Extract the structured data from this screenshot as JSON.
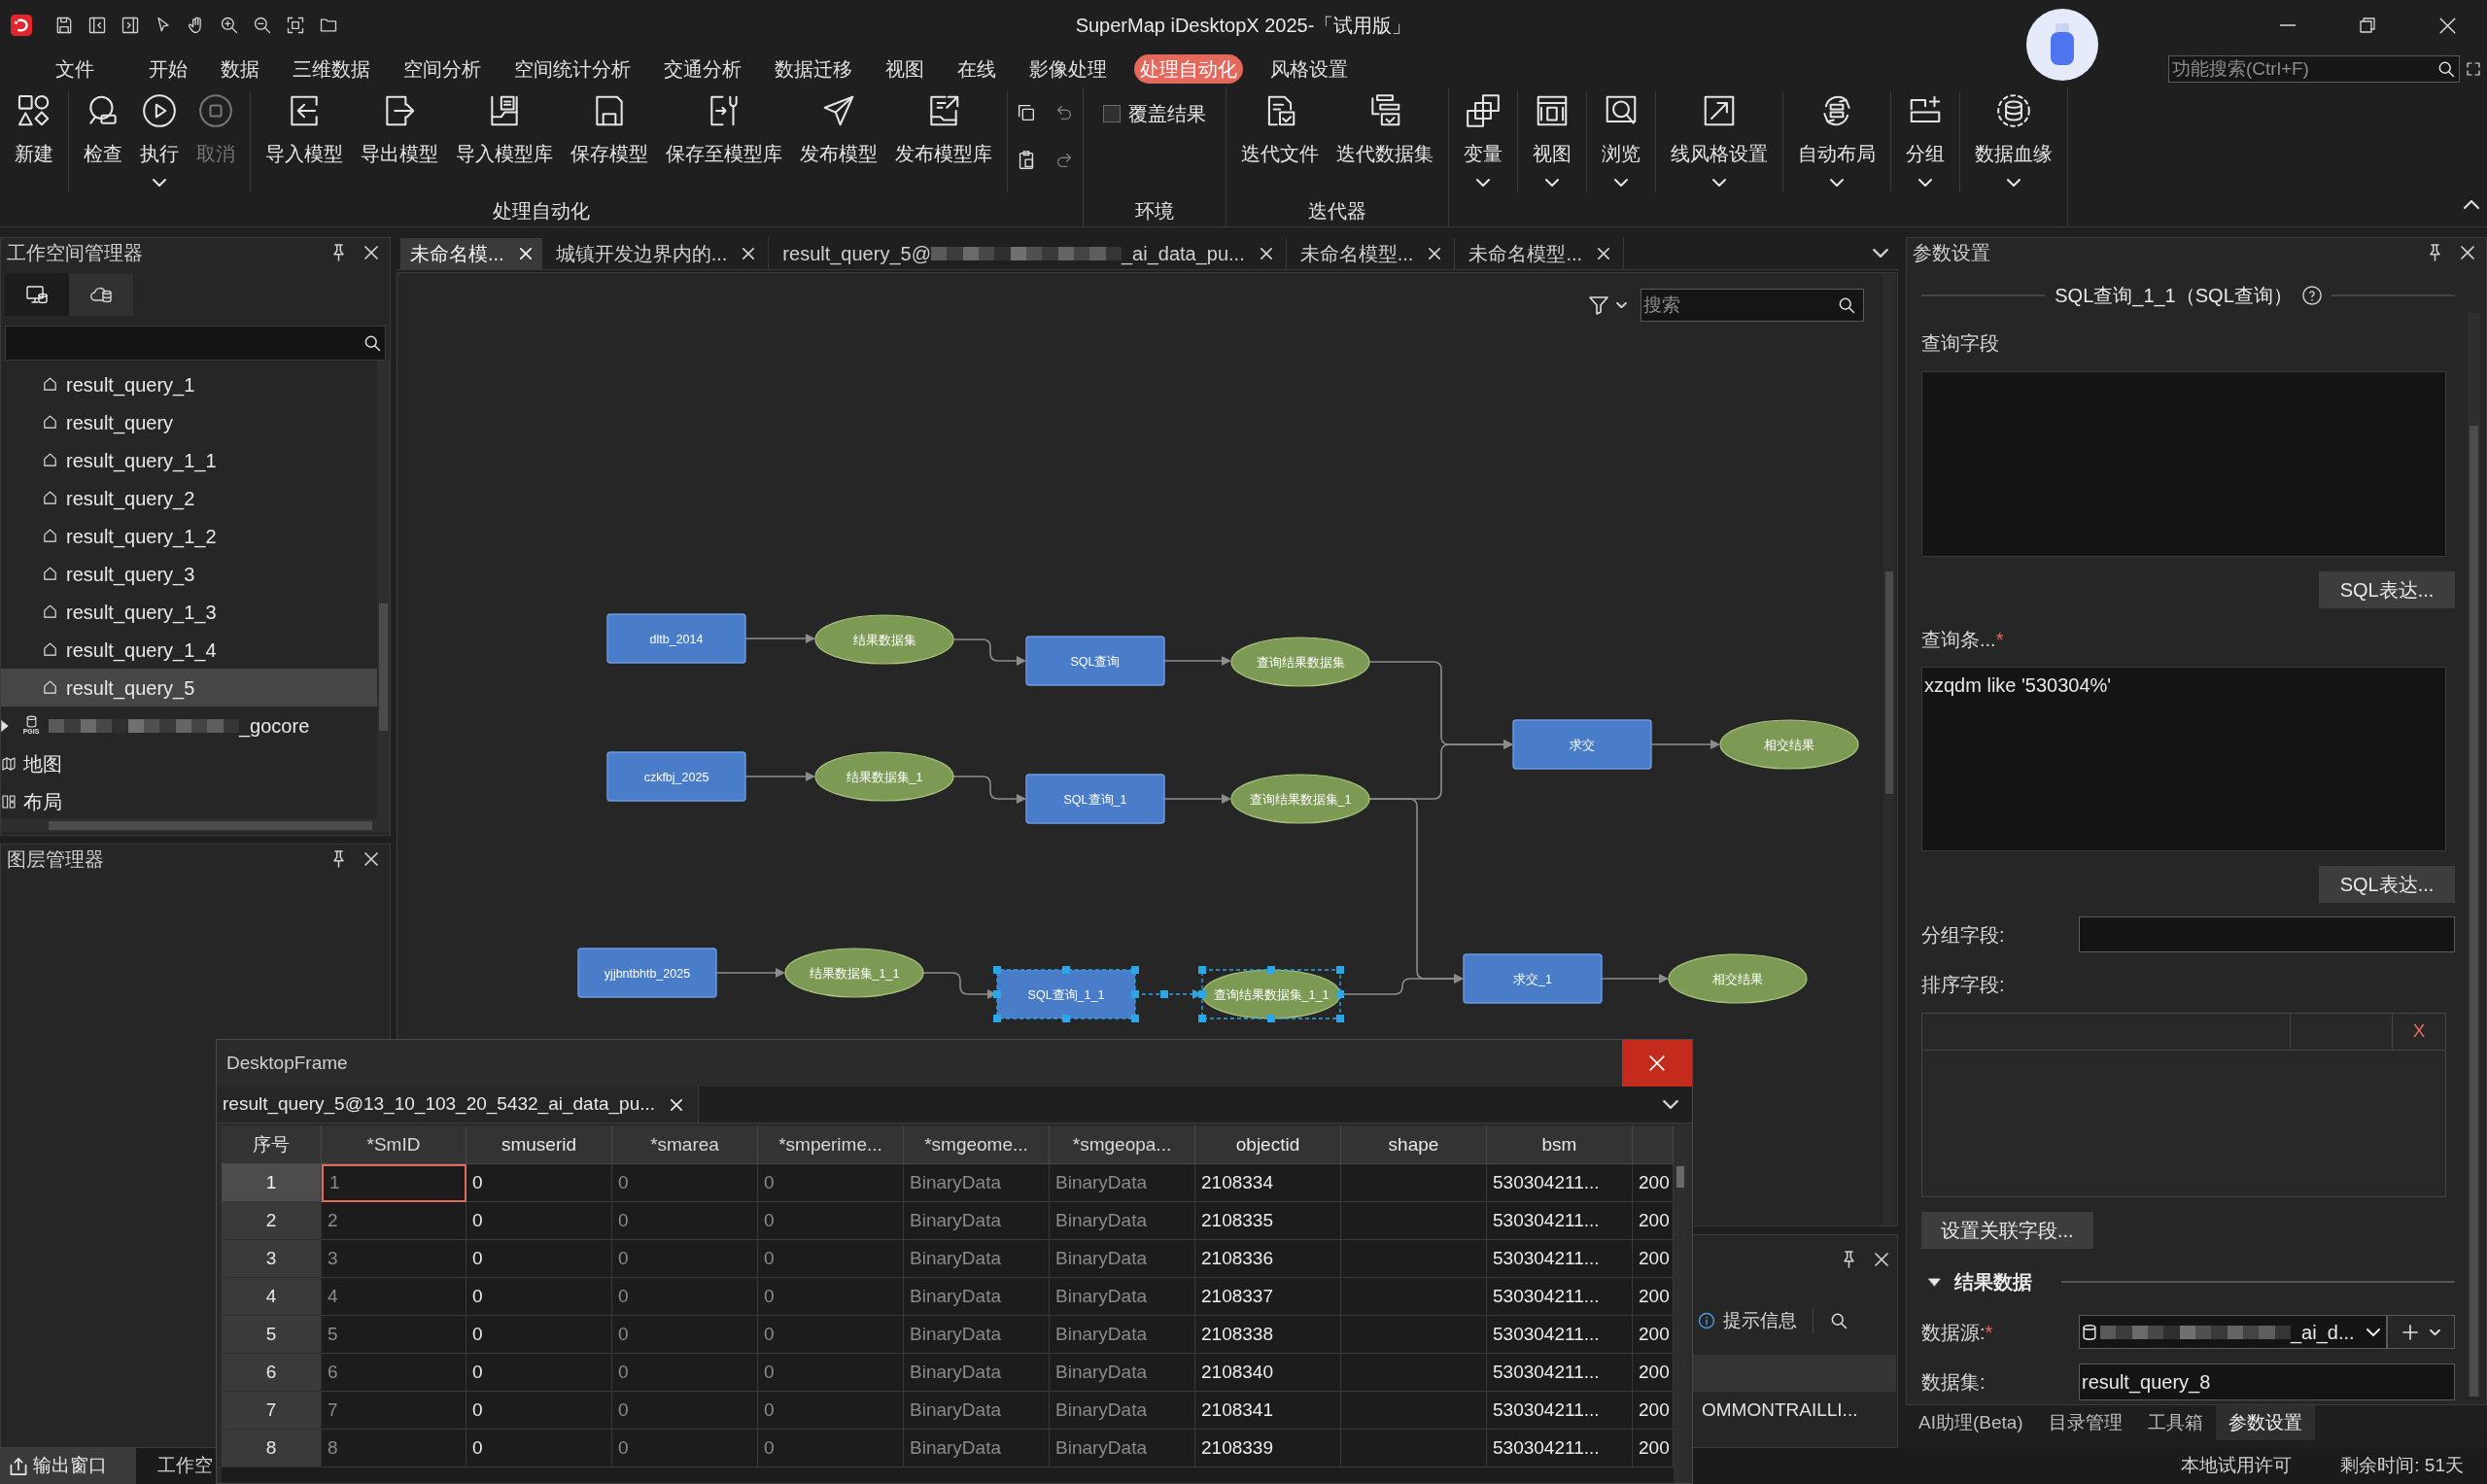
{
  "title_bar": {
    "title": "SuperMap iDesktopX 2025-「试用版」"
  },
  "menu_bar": {
    "items": [
      {
        "label": "文件",
        "selected": false
      },
      {
        "label": "开始",
        "selected": false
      },
      {
        "label": "数据",
        "selected": false
      },
      {
        "label": "三维数据",
        "selected": false
      },
      {
        "label": "空间分析",
        "selected": false
      },
      {
        "label": "空间统计分析",
        "selected": false
      },
      {
        "label": "交通分析",
        "selected": false
      },
      {
        "label": "数据迁移",
        "selected": false
      },
      {
        "label": "视图",
        "selected": false
      },
      {
        "label": "在线",
        "selected": false
      },
      {
        "label": "影像处理",
        "selected": false
      },
      {
        "label": "处理自动化",
        "selected": true
      },
      {
        "label": "风格设置",
        "selected": false
      }
    ],
    "search": {
      "placeholder": "功能搜索(Ctrl+F)"
    }
  },
  "ribbon": {
    "groups": [
      {
        "label": "处理自动化",
        "sections": [
          [
            {
              "kind": "large",
              "label": "新建",
              "dropdown": false,
              "disabled": false
            }
          ],
          [
            {
              "kind": "large",
              "label": "检查",
              "dropdown": false,
              "disabled": false
            },
            {
              "kind": "large",
              "label": "执行",
              "dropdown": true,
              "disabled": false
            },
            {
              "kind": "large",
              "label": "取消",
              "dropdown": false,
              "disabled": true
            }
          ],
          [
            {
              "kind": "large",
              "label": "导入模型",
              "dropdown": false,
              "disabled": false
            },
            {
              "kind": "large",
              "label": "导出模型",
              "dropdown": false,
              "disabled": false
            },
            {
              "kind": "large",
              "label": "导入模型库",
              "dropdown": false,
              "disabled": false
            },
            {
              "kind": "large",
              "label": "保存模型",
              "dropdown": false,
              "disabled": false
            },
            {
              "kind": "large",
              "label": "保存至模型库",
              "dropdown": false,
              "disabled": false
            },
            {
              "kind": "large",
              "label": "发布模型",
              "dropdown": false,
              "disabled": false
            },
            {
              "kind": "large",
              "label": "发布模型库",
              "dropdown": false,
              "disabled": false
            }
          ],
          [
            {
              "kind": "small",
              "disabled": false
            },
            {
              "kind": "small",
              "disabled": true
            },
            {
              "kind": "small",
              "disabled": false
            },
            {
              "kind": "small",
              "disabled": true
            }
          ]
        ]
      },
      {
        "label": "环境",
        "sections": [
          [
            {
              "kind": "checkbox",
              "label": "覆盖结果",
              "checked": false
            }
          ]
        ]
      },
      {
        "label": "迭代器",
        "sections": [
          [
            {
              "kind": "large",
              "label": "迭代文件",
              "dropdown": false,
              "disabled": false
            },
            {
              "kind": "large",
              "label": "迭代数据集",
              "dropdown": false,
              "disabled": false
            }
          ]
        ]
      },
      {
        "sections": [
          [
            {
              "kind": "large",
              "label": "变量",
              "dropdown": true,
              "disabled": false
            }
          ],
          [
            {
              "kind": "large",
              "label": "视图",
              "dropdown": true,
              "disabled": false
            }
          ],
          [
            {
              "kind": "large",
              "label": "浏览",
              "dropdown": true,
              "disabled": false
            }
          ],
          [
            {
              "kind": "large",
              "label": "线风格设置",
              "dropdown": true,
              "disabled": false
            }
          ],
          [
            {
              "kind": "large",
              "label": "自动布局",
              "dropdown": true,
              "disabled": false
            }
          ],
          [
            {
              "kind": "large",
              "label": "分组",
              "dropdown": true,
              "disabled": false
            }
          ],
          [
            {
              "kind": "large",
              "label": "数据血缘",
              "dropdown": true,
              "disabled": false
            }
          ]
        ]
      }
    ]
  },
  "workspace_panel": {
    "title": "工作空间管理器",
    "tabs": [
      {
        "selected": true
      },
      {
        "selected": false
      }
    ],
    "tree": [
      {
        "children": [
          {
            "children": [
              {
                "kind": "dataset",
                "label": "result_query_1",
                "selected": false
              },
              {
                "kind": "dataset",
                "label": "result_query",
                "selected": false
              },
              {
                "kind": "dataset",
                "label": "result_query_1_1",
                "selected": false
              },
              {
                "kind": "dataset",
                "label": "result_query_2",
                "selected": false
              },
              {
                "kind": "dataset",
                "label": "result_query_1_2",
                "selected": false
              },
              {
                "kind": "dataset",
                "label": "result_query_3",
                "selected": false
              },
              {
                "kind": "dataset",
                "label": "result_query_1_3",
                "selected": false
              },
              {
                "kind": "dataset",
                "label": "result_query_1_4",
                "selected": false
              },
              {
                "kind": "dataset",
                "label": "result_query_5",
                "selected": true
              }
            ]
          },
          {
            "kind": "datasource",
            "badge": "PGIS",
            "segments": [
              {
                "kind": "redacted"
              },
              {
                "kind": "text",
                "text": "_gocore"
              }
            ],
            "expanded": false,
            "selected": false
          }
        ]
      },
      {
        "kind": "maps",
        "label": "地图",
        "selected": false
      },
      {
        "kind": "layouts",
        "label": "布局",
        "selected": false
      }
    ]
  },
  "layer_panel": {
    "title": "图层管理器"
  },
  "document_tabs": [
    {
      "label": "未命名模...",
      "selected": true
    },
    {
      "label": "城镇开发边界内的...",
      "selected": false
    },
    {
      "segments": [
        {
          "kind": "text",
          "text": "result_query_5@"
        },
        {
          "kind": "redacted"
        },
        {
          "kind": "text",
          "text": "_ai_data_pu..."
        }
      ],
      "selected": false
    },
    {
      "label": "未命名模型...",
      "selected": false
    },
    {
      "label": "未命名模型...",
      "selected": false
    }
  ],
  "model_canvas": {
    "search": {
      "placeholder": "搜索"
    },
    "nodes": [
      {
        "kind": "process",
        "label": "dltb_2014",
        "selected": false
      },
      {
        "kind": "data",
        "label": "结果数据集",
        "selected": false
      },
      {
        "kind": "process",
        "label": "SQL查询",
        "selected": false
      },
      {
        "kind": "data",
        "label": "查询结果数据集",
        "selected": false
      },
      {
        "kind": "process",
        "label": "求交",
        "selected": false
      },
      {
        "kind": "data",
        "label": "相交结果",
        "selected": false
      },
      {
        "kind": "process",
        "label": "czkfbj_2025",
        "selected": false
      },
      {
        "kind": "data",
        "label": "结果数据集_1",
        "selected": false
      },
      {
        "kind": "process",
        "label": "SQL查询_1",
        "selected": false
      },
      {
        "kind": "data",
        "label": "查询结果数据集_1",
        "selected": false
      },
      {
        "kind": "process",
        "label": "yjjbntbhtb_2025",
        "selected": false
      },
      {
        "kind": "data",
        "label": "结果数据集_1_1",
        "selected": false
      },
      {
        "kind": "process",
        "label": "SQL查询_1_1",
        "selected": true
      },
      {
        "kind": "data",
        "label": "查询结果数据集_1_1",
        "selected": true
      },
      {
        "kind": "process",
        "label": "求交_1",
        "selected": false
      },
      {
        "kind": "data",
        "label": "相交结果",
        "selected": false
      }
    ],
    "links": [
      {
        "selected": false
      },
      {
        "selected": false
      },
      {
        "selected": false
      },
      {
        "selected": false
      },
      {
        "selected": false
      },
      {
        "selected": false
      },
      {
        "selected": false
      },
      {
        "selected": false
      },
      {
        "selected": false
      },
      {
        "selected": false
      },
      {
        "selected": false
      },
      {
        "selected": false
      },
      {
        "selected": true
      },
      {
        "selected": false
      },
      {
        "selected": false
      }
    ]
  },
  "output_panel": {
    "filter": "提示信息",
    "rows": [
      "OMMONTRAILLI..."
    ]
  },
  "desktop_frame": {
    "title": "DesktopFrame",
    "tabs": [
      {
        "label": "result_query_5@13_10_103_20_5432_ai_data_pu...",
        "selected": true
      }
    ],
    "table": {
      "row_header": "序号",
      "columns": [
        {
          "label": "*SmID",
          "read_only": true
        },
        {
          "label": "smuserid",
          "read_only": false
        },
        {
          "label": "*smarea",
          "read_only": true
        },
        {
          "label": "*smperime...",
          "read_only": true
        },
        {
          "label": "*smgeome...",
          "read_only": true
        },
        {
          "label": "*smgeopa...",
          "read_only": true
        },
        {
          "label": "objectid",
          "read_only": false
        },
        {
          "label": "shape",
          "read_only": false
        },
        {
          "label": "bsm",
          "read_only": false
        },
        {
          "read_only": false
        }
      ],
      "rows": [
        {
          "number": "1",
          "selected": true,
          "cells": [
            "1",
            "0",
            "0",
            "0",
            "BinaryData",
            "BinaryData",
            "2108334",
            null,
            "530304211...",
            "200"
          ]
        },
        {
          "number": "2",
          "selected": false,
          "cells": [
            "2",
            "0",
            "0",
            "0",
            "BinaryData",
            "BinaryData",
            "2108335",
            null,
            "530304211...",
            "200"
          ]
        },
        {
          "number": "3",
          "selected": false,
          "cells": [
            "3",
            "0",
            "0",
            "0",
            "BinaryData",
            "BinaryData",
            "2108336",
            null,
            "530304211...",
            "200"
          ]
        },
        {
          "number": "4",
          "selected": false,
          "cells": [
            "4",
            "0",
            "0",
            "0",
            "BinaryData",
            "BinaryData",
            "2108337",
            null,
            "530304211...",
            "200"
          ]
        },
        {
          "number": "5",
          "selected": false,
          "cells": [
            "5",
            "0",
            "0",
            "0",
            "BinaryData",
            "BinaryData",
            "2108338",
            null,
            "530304211...",
            "200"
          ]
        },
        {
          "number": "6",
          "selected": false,
          "cells": [
            "6",
            "0",
            "0",
            "0",
            "BinaryData",
            "BinaryData",
            "2108340",
            null,
            "530304211...",
            "200"
          ]
        },
        {
          "number": "7",
          "selected": false,
          "cells": [
            "7",
            "0",
            "0",
            "0",
            "BinaryData",
            "BinaryData",
            "2108341",
            null,
            "530304211...",
            "200"
          ]
        },
        {
          "number": "8",
          "selected": false,
          "cells": [
            "8",
            "0",
            "0",
            "0",
            "BinaryData",
            "BinaryData",
            "2108339",
            null,
            "530304211...",
            "200"
          ]
        }
      ]
    }
  },
  "parameters_panel": {
    "title": "参数设置",
    "heading": "SQL查询_1_1（SQL查询）",
    "query_fields": {
      "label": "查询字段",
      "button": "SQL表达..."
    },
    "query_condition": {
      "label": "查询条...",
      "required_mark": "*",
      "value": "xzqdm like '530304%'",
      "button": "SQL表达..."
    },
    "group_field": {
      "label": "分组字段:"
    },
    "sort_field": {
      "label": "排序字段:",
      "remove": "X"
    },
    "relation_button": "设置关联字段...",
    "result_section": {
      "label": "结果数据",
      "expanded": true,
      "datasource": {
        "label": "数据源:",
        "required_mark": "*",
        "segments": [
          {
            "kind": "redacted"
          },
          {
            "kind": "text",
            "text": "_ai_d..."
          }
        ]
      },
      "dataset": {
        "label": "数据集:",
        "value": "result_query_8"
      }
    },
    "tabs": [
      {
        "label": "AI助理(Beta)",
        "selected": false
      },
      {
        "label": "目录管理",
        "selected": false
      },
      {
        "label": "工具箱",
        "selected": false
      },
      {
        "label": "参数设置",
        "selected": true
      }
    ]
  },
  "status_bar": {
    "tabs": [
      {
        "label": "输出窗口",
        "selected": true
      },
      {
        "label": "工作空",
        "selected": false
      }
    ],
    "license": "本地试用许可",
    "remaining": "剩余时间: 51天"
  }
}
